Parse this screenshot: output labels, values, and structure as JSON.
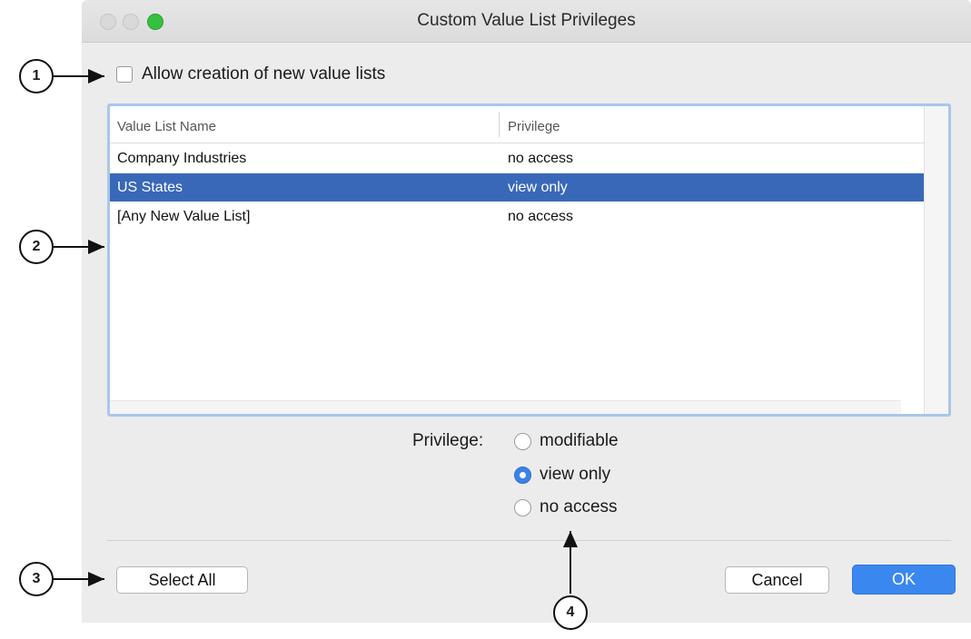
{
  "window": {
    "title": "Custom Value List Privileges"
  },
  "options": {
    "allow_new_label": "Allow creation of new value lists",
    "allow_new_checked": false
  },
  "table": {
    "columns": [
      "Value List Name",
      "Privilege"
    ],
    "rows": [
      {
        "name": "Company Industries",
        "privilege": "no access",
        "selected": false
      },
      {
        "name": "US States",
        "privilege": "view only",
        "selected": true
      },
      {
        "name": "[Any New Value List]",
        "privilege": "no access",
        "selected": false
      }
    ]
  },
  "privilege": {
    "label": "Privilege:",
    "options": [
      "modifiable",
      "view only",
      "no access"
    ],
    "selected": "view only"
  },
  "buttons": {
    "select_all": "Select All",
    "cancel": "Cancel",
    "ok": "OK"
  },
  "callouts": [
    "1",
    "2",
    "3",
    "4"
  ],
  "colors": {
    "selection": "#3968b9",
    "default_button": "#3b87f0",
    "zoom_button": "#35c140",
    "focus_ring": "#a9c6ea"
  }
}
